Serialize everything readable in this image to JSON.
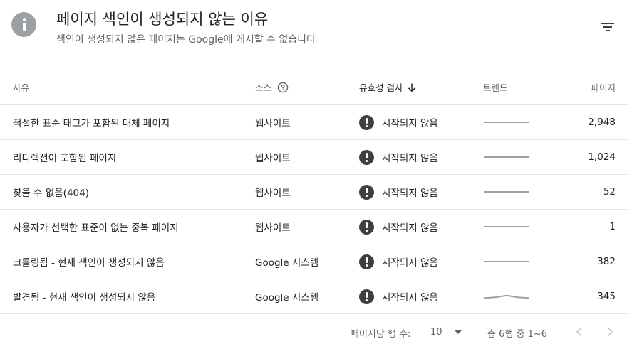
{
  "header": {
    "icon": "info-icon",
    "title": "페이지 색인이 생성되지 않는 이유",
    "subtitle": "색인이 생성되지 않은 페이지는 Google에 게시할 수 없습니다",
    "filter_icon": "filter-icon"
  },
  "table": {
    "columns": {
      "reason": "사유",
      "source": "소스",
      "validation": "유효성 검사",
      "trend": "트렌드",
      "pages": "페이지"
    },
    "sort": {
      "column": "validation",
      "direction": "descending"
    },
    "rows": [
      {
        "reason": "적절한 표준 태그가 포함된 대체 페이지",
        "source": "웹사이트",
        "validation": "시작되지 않음",
        "trend": [
          0.5,
          0.5,
          0.5,
          0.5,
          0.5
        ],
        "pages": "2,948"
      },
      {
        "reason": "리디렉션이 포함된 페이지",
        "source": "웹사이트",
        "validation": "시작되지 않음",
        "trend": [
          0.5,
          0.5,
          0.5,
          0.5,
          0.5
        ],
        "pages": "1,024"
      },
      {
        "reason": "찾을 수 없음(404)",
        "source": "웹사이트",
        "validation": "시작되지 않음",
        "trend": [
          0.5,
          0.5,
          0.5,
          0.5,
          0.5
        ],
        "pages": "52"
      },
      {
        "reason": "사용자가 선택한 표준이 없는 중복 페이지",
        "source": "웹사이트",
        "validation": "시작되지 않음",
        "trend": [
          0.5,
          0.5,
          0.5,
          0.5,
          0.5
        ],
        "pages": "1"
      },
      {
        "reason": "크롤링됨 - 현재 색인이 생성되지 않음",
        "source": "Google 시스템",
        "validation": "시작되지 않음",
        "trend": [
          0.5,
          0.5,
          0.5,
          0.5,
          0.5
        ],
        "pages": "382"
      },
      {
        "reason": "발견됨 - 현재 색인이 생성되지 않음",
        "source": "Google 시스템",
        "validation": "시작되지 않음",
        "trend": [
          0.4,
          0.45,
          0.55,
          0.45,
          0.4
        ],
        "pages": "345"
      }
    ]
  },
  "footer": {
    "rows_per_page_label": "페이지당 행 수:",
    "rows_per_page_value": "10",
    "range_text": "총 6행 중 1~6",
    "prev_icon": "chevron-left-icon",
    "next_icon": "chevron-right-icon"
  },
  "colors": {
    "status_icon": "#3c4043",
    "trend_line": "#9aa0a6",
    "divider": "#e0e0e0",
    "muted_text": "#5f6368"
  }
}
